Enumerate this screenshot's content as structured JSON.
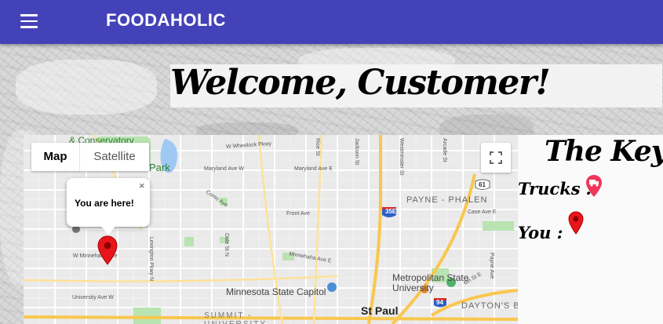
{
  "appbar": {
    "title": "FOODAHOLIC"
  },
  "welcome": {
    "heading": "Welcome, Customer!"
  },
  "key": {
    "title": "The Key",
    "trucks_label": "Trucks :",
    "you_label": "You :"
  },
  "map": {
    "type_map_label": "Map",
    "type_satellite_label": "Satellite",
    "info_text": "You are here!",
    "info_close": "×",
    "labels": {
      "conservatory": "& Conservatory",
      "park": "Park",
      "wheelock": "W Wheelock Pkwy",
      "maryland_w": "Maryland Ave W",
      "maryland_e": "Maryland Ave E",
      "payne": "PAYNE - PHALEN",
      "front": "Front Ave",
      "como": "Como Ave",
      "minnehaha_w": "W Minnehaha Ave",
      "minnehaha_e": "Minnehaha Ave E",
      "case": "Case Ave E",
      "capitol": "Minnesota State Capitol",
      "metro": "Metropolitan State University",
      "stpaul": "St Paul",
      "dayton": "DAYTON'S BL",
      "summit": "SUMMIT - UNIVERSITY",
      "university": "University Ave W",
      "i35e": "35E",
      "us61": "61",
      "i94": "94",
      "dale": "Dale St N",
      "lexington": "Lexington Pkwy N",
      "rice": "Rice St",
      "jackson": "Jackson St",
      "westminster": "Westminster St",
      "arcade": "Arcade St",
      "sixth": "6th St E",
      "payne_ave": "Payne Ave"
    }
  },
  "colors": {
    "appbar": "#4442b8",
    "pin_red": "#e8161c",
    "truck_pin": "#f0365a",
    "highway": "#f9c74f",
    "park_green": "#b9e3b1",
    "water": "#9fc8f2"
  }
}
